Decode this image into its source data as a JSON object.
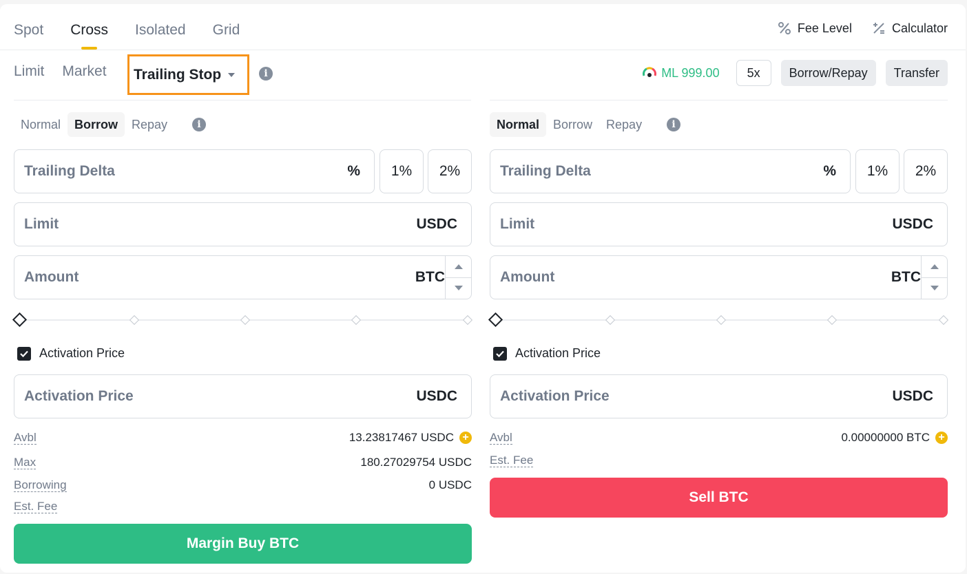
{
  "tabs": [
    "Spot",
    "Cross",
    "Isolated",
    "Grid"
  ],
  "active_tab": "Cross",
  "tools": {
    "fee_level": "Fee Level",
    "calculator": "Calculator"
  },
  "order_types": {
    "limit": "Limit",
    "market": "Market",
    "trailing_stop": "Trailing Stop"
  },
  "margin": {
    "ml": "ML 999.00",
    "leverage": "5x",
    "borrow_repay": "Borrow/Repay",
    "transfer": "Transfer"
  },
  "buy": {
    "modes": [
      "Normal",
      "Borrow",
      "Repay"
    ],
    "active_mode": "Borrow",
    "trailing_delta": {
      "label": "Trailing Delta",
      "unit": "%"
    },
    "pct_buttons": [
      "1%",
      "2%"
    ],
    "limit": {
      "label": "Limit",
      "unit": "USDC"
    },
    "amount": {
      "label": "Amount",
      "unit": "BTC"
    },
    "slider_value": 0,
    "activation_checkbox": {
      "label": "Activation Price",
      "checked": true
    },
    "activation_price": {
      "label": "Activation Price",
      "unit": "USDC"
    },
    "avbl": {
      "label": "Avbl",
      "value": "13.23817467 USDC"
    },
    "max": {
      "label": "Max",
      "value": "180.27029754 USDC"
    },
    "borrowing": {
      "label": "Borrowing",
      "value": "0 USDC"
    },
    "est_fee": {
      "label": "Est. Fee"
    },
    "button": "Margin Buy BTC"
  },
  "sell": {
    "modes": [
      "Normal",
      "Borrow",
      "Repay"
    ],
    "active_mode": "Normal",
    "trailing_delta": {
      "label": "Trailing Delta",
      "unit": "%"
    },
    "pct_buttons": [
      "1%",
      "2%"
    ],
    "limit": {
      "label": "Limit",
      "unit": "USDC"
    },
    "amount": {
      "label": "Amount",
      "unit": "BTC"
    },
    "slider_value": 0,
    "activation_checkbox": {
      "label": "Activation Price",
      "checked": true
    },
    "activation_price": {
      "label": "Activation Price",
      "unit": "USDC"
    },
    "avbl": {
      "label": "Avbl",
      "value": "0.00000000 BTC"
    },
    "est_fee": {
      "label": "Est. Fee"
    },
    "button": "Sell BTC"
  },
  "colors": {
    "accent": "#f0b90b",
    "buy": "#2ebd85",
    "sell": "#f6465d",
    "highlight": "#f7931a"
  }
}
